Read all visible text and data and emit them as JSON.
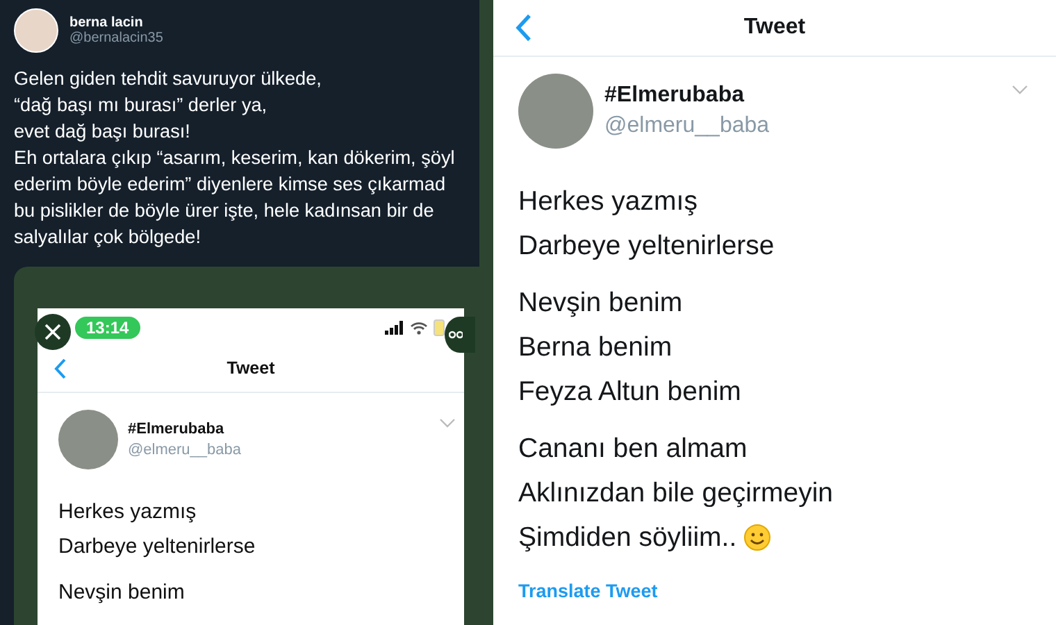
{
  "left_tweet": {
    "author": {
      "name": "berna lacin",
      "handle": "@bernalacin35"
    },
    "lines": [
      "Gelen giden tehdit savuruyor ülkede,",
      " “dağ başı mı burası” derler ya,",
      "evet dağ başı burası!",
      "Eh ortalara çıkıp “asarım, keserim, kan dökerim, şöyl",
      "ederim böyle ederim” diyenlere kimse ses çıkarmad",
      "bu pislikler de böyle ürer işte, hele kadınsan bir de",
      "salyalılar çok bölgede!"
    ],
    "attached_screenshot": {
      "status_time": "13:14",
      "header_title": "Tweet",
      "author": {
        "name": "#Elmerubaba",
        "handle": "@elmeru__baba"
      },
      "paragraphs": [
        [
          "Herkes yazmış",
          "Darbeye yeltenirlerse"
        ],
        [
          "Nevşin benim"
        ]
      ]
    }
  },
  "right_tweet": {
    "header_title": "Tweet",
    "author": {
      "name": "#Elmerubaba",
      "handle": "@elmeru__baba"
    },
    "paragraphs": [
      [
        {
          "kind": "plain",
          "text": "Herkes yazmış"
        },
        {
          "kind": "plain",
          "text": "Darbeye yeltenirlerse"
        }
      ],
      [
        {
          "kind": "plain",
          "text": "Nevşin benim"
        },
        {
          "kind": "plain",
          "text": "Berna benim"
        },
        {
          "kind": "plain",
          "text": "Feyza Altun benim"
        }
      ],
      [
        {
          "kind": "plain",
          "text": "Cananı ben almam"
        },
        {
          "kind": "plain",
          "text": "Aklınızdan bile geçirmeyin"
        },
        {
          "kind": "smiley",
          "text": "Şimdiden söyliim.."
        }
      ]
    ],
    "translate_link": "Translate Tweet"
  }
}
